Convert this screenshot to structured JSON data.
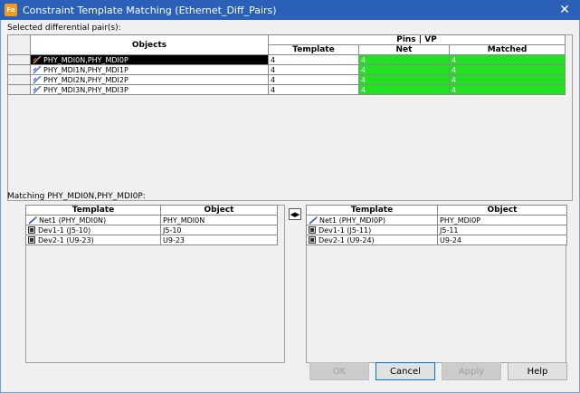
{
  "window": {
    "title": "Constraint Template Matching (Ethernet_Diff_Pairs)",
    "app_icon_text": "Fo",
    "close_glyph": "✕"
  },
  "selected_pairs": {
    "label": "Selected differential pair(s):",
    "header_objects": "Objects",
    "header_pins_vp": "Pins | VP",
    "header_template": "Template",
    "header_net": "Net",
    "header_matched": "Matched",
    "rows": [
      {
        "name": "PHY_MDI0N,PHY_MDI0P",
        "template": "4",
        "net": "4",
        "matched": "4",
        "selected": true
      },
      {
        "name": "PHY_MDI1N,PHY_MDI1P",
        "template": "4",
        "net": "4",
        "matched": "4",
        "selected": false
      },
      {
        "name": "PHY_MDI2N,PHY_MDI2P",
        "template": "4",
        "net": "4",
        "matched": "4",
        "selected": false
      },
      {
        "name": "PHY_MDI3N,PHY_MDI3P",
        "template": "4",
        "net": "4",
        "matched": "4",
        "selected": false
      }
    ]
  },
  "matching": {
    "label": "Matching PHY_MDI0N,PHY_MDI0P:",
    "left": {
      "header_template": "Template",
      "header_object": "Object",
      "rows": [
        {
          "template": "Net1 (PHY_MDI0N)",
          "object": "PHY_MDI0N",
          "icon": "net-icon"
        },
        {
          "template": "Dev1-1 (J5-10)",
          "object": "J5-10",
          "icon": "component-icon"
        },
        {
          "template": "Dev2-1 (U9-23)",
          "object": "U9-23",
          "icon": "component-icon"
        }
      ]
    },
    "right": {
      "header_template": "Template",
      "header_object": "Object",
      "rows": [
        {
          "template": "Net1 (PHY_MDI0P)",
          "object": "PHY_MDI0P",
          "icon": "net-icon"
        },
        {
          "template": "Dev1-1 (J5-11)",
          "object": "J5-11",
          "icon": "component-icon"
        },
        {
          "template": "Dev2-1 (U9-24)",
          "object": "U9-24",
          "icon": "component-icon"
        }
      ]
    },
    "swap_glyph": "◀▶"
  },
  "buttons": {
    "ok": "OK",
    "cancel": "Cancel",
    "apply": "Apply",
    "help": "Help"
  },
  "colors": {
    "titlebar": "#2a60b8",
    "matched_green": "#22e022",
    "selection": "#000000"
  }
}
